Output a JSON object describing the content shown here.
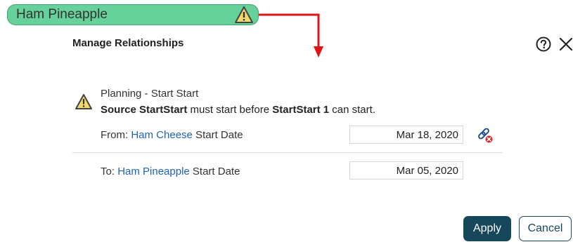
{
  "task_bar": {
    "label": "Ham Pineapple",
    "fill_color": "#66d19a"
  },
  "dialog": {
    "title": "Manage Relationships",
    "help_icon": "question-circle-icon",
    "close_icon": "close-icon"
  },
  "relationship": {
    "type_label": "Planning - Start Start",
    "message": {
      "source_name": "Source StartStart",
      "middle": " must start before ",
      "target_name": "StartStart 1",
      "end": " can start."
    },
    "from": {
      "prefix": "From: ",
      "task_link": "Ham Cheese",
      "suffix": " Start Date",
      "date": "Mar 18, 2020"
    },
    "to": {
      "prefix": "To: ",
      "task_link": "Ham Pineapple",
      "suffix": " Start Date",
      "date": "Mar 05, 2020"
    },
    "unlink_icon": "unlink-icon"
  },
  "buttons": {
    "apply": "Apply",
    "cancel": "Cancel"
  },
  "colors": {
    "arrow": "#e01515",
    "primary": "#16475b",
    "link": "#1f63b5",
    "warning": "#f3d86b"
  }
}
